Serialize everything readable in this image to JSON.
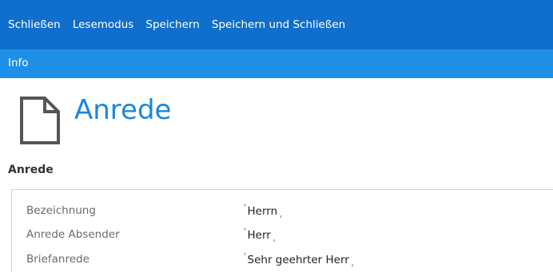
{
  "toolbar": {
    "commands": [
      "Schließen",
      "Lesemodus",
      "Speichern",
      "Speichern und Schließen"
    ]
  },
  "tabs": {
    "info": "Info"
  },
  "page": {
    "title": "Anrede",
    "icon": "document-icon"
  },
  "section": {
    "title": "Anrede"
  },
  "fields": [
    {
      "label": "Bezeichnung",
      "value": "Herrn"
    },
    {
      "label": "Anrede Absender",
      "value": "Herr"
    },
    {
      "label": "Briefanrede",
      "value": "Sehr geehrter Herr"
    }
  ],
  "markers": {
    "open": "⸢",
    "close": "⸥"
  },
  "colors": {
    "toolbar": "#106fcc",
    "tabbar": "#1e8fe6",
    "title": "#1b87d9"
  }
}
